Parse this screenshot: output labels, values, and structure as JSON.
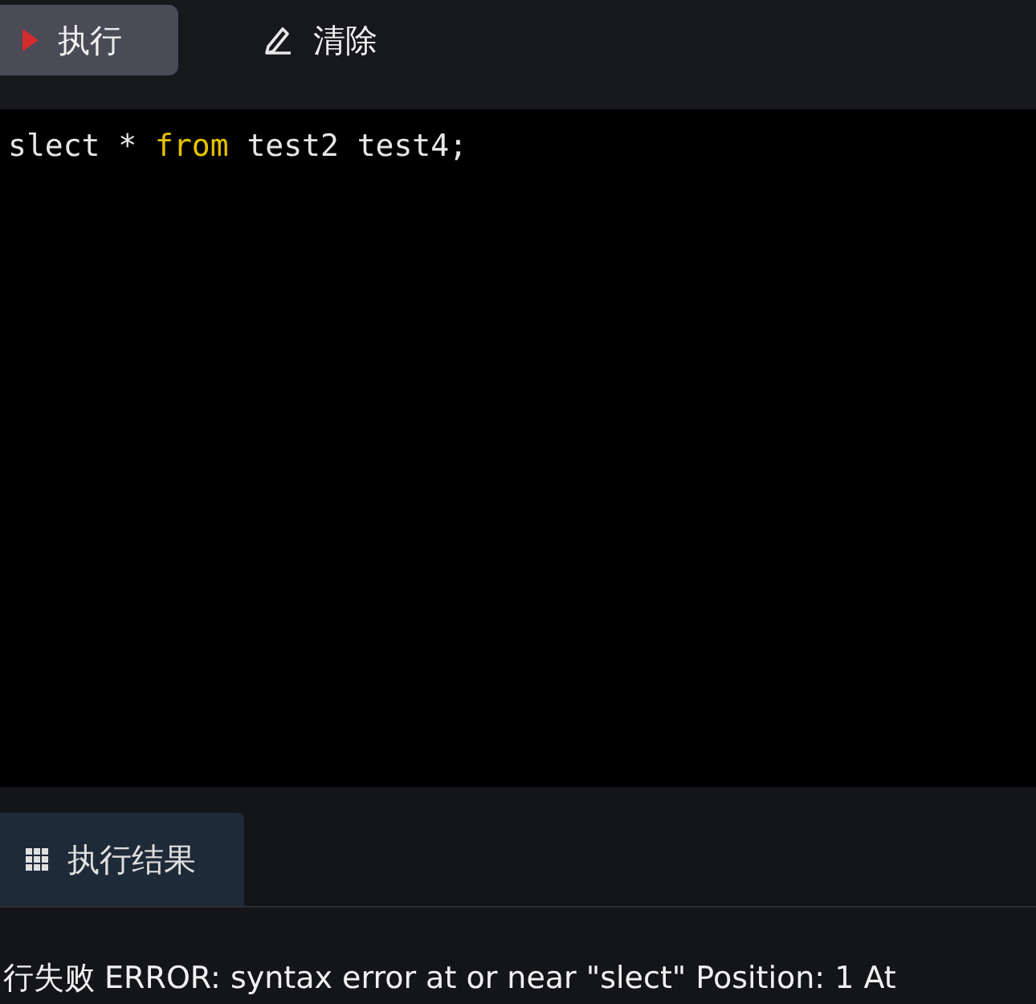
{
  "toolbar": {
    "buttons": [
      {
        "kind": "run",
        "label": "执行"
      },
      {
        "kind": "clear",
        "label": "清除"
      }
    ]
  },
  "editor": {
    "lines": [
      [
        {
          "kind": "plain",
          "text": "slect * "
        },
        {
          "kind": "keyword",
          "text": "from"
        },
        {
          "kind": "plain",
          "text": " test2 test4;"
        }
      ]
    ]
  },
  "result_tabs": [
    {
      "label": "执行结果",
      "selected": true
    }
  ],
  "message": "行失败 ERROR: syntax error at or near \"slect\" Position: 1 At"
}
